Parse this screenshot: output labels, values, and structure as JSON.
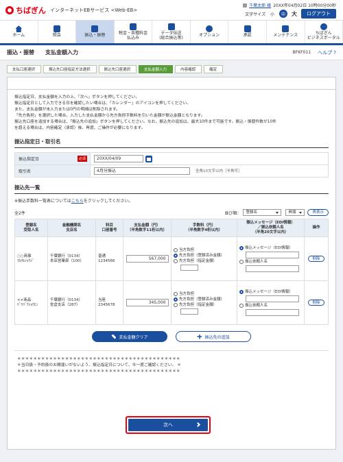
{
  "header": {
    "brand": "ちばぎん",
    "service": "インターネットEBサービス <Web-EB>",
    "user_name": "千葉太郎 様",
    "last_login": "20XX年04月02日 10時00分00秒",
    "font_size_label": "文字サイズ",
    "font_small": "小",
    "font_mid": "中",
    "font_large": "大",
    "logout": "ログアウト"
  },
  "nav": [
    {
      "label": "ホーム",
      "icon": "home-icon"
    },
    {
      "label": "照会",
      "icon": "document-icon"
    },
    {
      "label": "振込・振替",
      "icon": "transfer-icon"
    },
    {
      "label": "税金・各種料金\n払込み",
      "icon": "tax-icon"
    },
    {
      "label": "データ伝送\n(総合振込等)",
      "icon": "data-icon"
    },
    {
      "label": "オプション",
      "icon": "option-icon"
    },
    {
      "label": "承認",
      "icon": "approve-icon"
    },
    {
      "label": "メンテナンス",
      "icon": "maintenance-icon"
    },
    {
      "label": "ちばぎん\nビジネスポータル",
      "icon": "portal-icon"
    }
  ],
  "title": {
    "section": "振込・振替",
    "page": "支払金額入力",
    "code": "BFKF011",
    "help": "ヘルプ"
  },
  "steps": [
    "支払口座選択",
    "振込先口座指定方法選択",
    "振込先口座選択",
    "支払金額入力",
    "内容確認",
    "確定"
  ],
  "instructions": [
    "振込指定日、支払金額を入力の上、「次へ」ボタンを押してください。",
    "振込指定日として入力できる日を確認したい場合は、「カレンダー」のアイコンを押してください。",
    "また、支払金額が未入力または0円の明細は削除されます。",
    "「先方負担」を選択した場合、入力した支払金額から先方負担手数料を引いた金額が振込金額となります。",
    "振込先口座を追加する場合は、「振込先の追加」ボタンを押してください。なお、振込先の追加は、最大10件まで可能です。振込・振替件数が10件",
    "を超える場合は、内容確定（承認）後、再度、ご操作が必要になります。"
  ],
  "section_date": {
    "heading": "振込指定日・取引名",
    "date_label": "振込指定日",
    "required": "必須",
    "date_value": "20XX/04/09",
    "name_label": "取引名",
    "name_value": "4月分振込",
    "name_hint": "全角10文字以内［半角可］"
  },
  "section_list": {
    "heading": "振込先一覧",
    "fee_note_pre": "※振込手数料一覧表については",
    "fee_note_link": "こちら",
    "fee_note_post": "をクリックしてください。",
    "count": "全2件",
    "sort_label": "並び順：",
    "sort_value": "登録名",
    "order_value": "昇順",
    "redisplay": "再表示",
    "columns": [
      "登録名\n受取人名",
      "金融機関名\n支店名",
      "科目\n口座番号",
      "支払金額（円）\n（半角数字11桁以内）",
      "手数料（円）\n（半角数字4桁以内）",
      "振込メッセージ（EDI情報）\n／振込依頼人名\n（半角20文字以内）",
      "操作"
    ],
    "rows": [
      {
        "reg_name": "○○商事",
        "recipient": "ﾏﾙﾏﾙｼｮｳｼﾞ",
        "bank": "千葉銀行（0134）",
        "branch": "本店営業部（100）",
        "type": "普通",
        "account": "1234566",
        "amount": "567,000",
        "fee_opts": [
          "当方負担",
          "先方負担（登録済み金額）",
          "先方負担（指定金額）"
        ],
        "msg_opts": [
          "振込メッセージ（EDI情報）",
          "振込依頼人名"
        ],
        "delete": "削除"
      },
      {
        "reg_name": "××商品",
        "recipient": "ﾊﾞﾂﾊﾞﾂｼｮｳﾋﾝ",
        "bank": "千葉銀行（0134）",
        "branch": "佐倉支店（287）",
        "type": "当座",
        "account": "2345678",
        "amount": "345,000",
        "fee_opts": [
          "当方負担",
          "先方負担（登録済み金額）",
          "先方負担（指定金額）"
        ],
        "msg_opts": [
          "振込メッセージ（EDI情報）",
          "振込依頼人名"
        ],
        "delete": "削除"
      }
    ]
  },
  "buttons": {
    "clear": "支払金額クリア",
    "add": "振込先の追加",
    "next": "次へ"
  },
  "warning": {
    "stars1": "＊＊＊＊＊＊＊＊＊＊＊＊＊＊＊＊＊＊＊＊＊＊＊＊＊＊＊＊＊＊＊＊＊＊＊＊＊＊＊＊＊",
    "text": "＊当日扱・予約扱のお間違いがないよう、振込指定日について、今一度ご確認ください。 ＊",
    "stars2": "＊＊＊＊＊＊＊＊＊＊＊＊＊＊＊＊＊＊＊＊＊＊＊＊＊＊＊＊＊＊＊＊＊＊＊＊＊＊＊＊＊"
  },
  "colors": {
    "accent": "#1a4fa0",
    "brand": "#e60012",
    "step_current": "#5a9c3a"
  }
}
